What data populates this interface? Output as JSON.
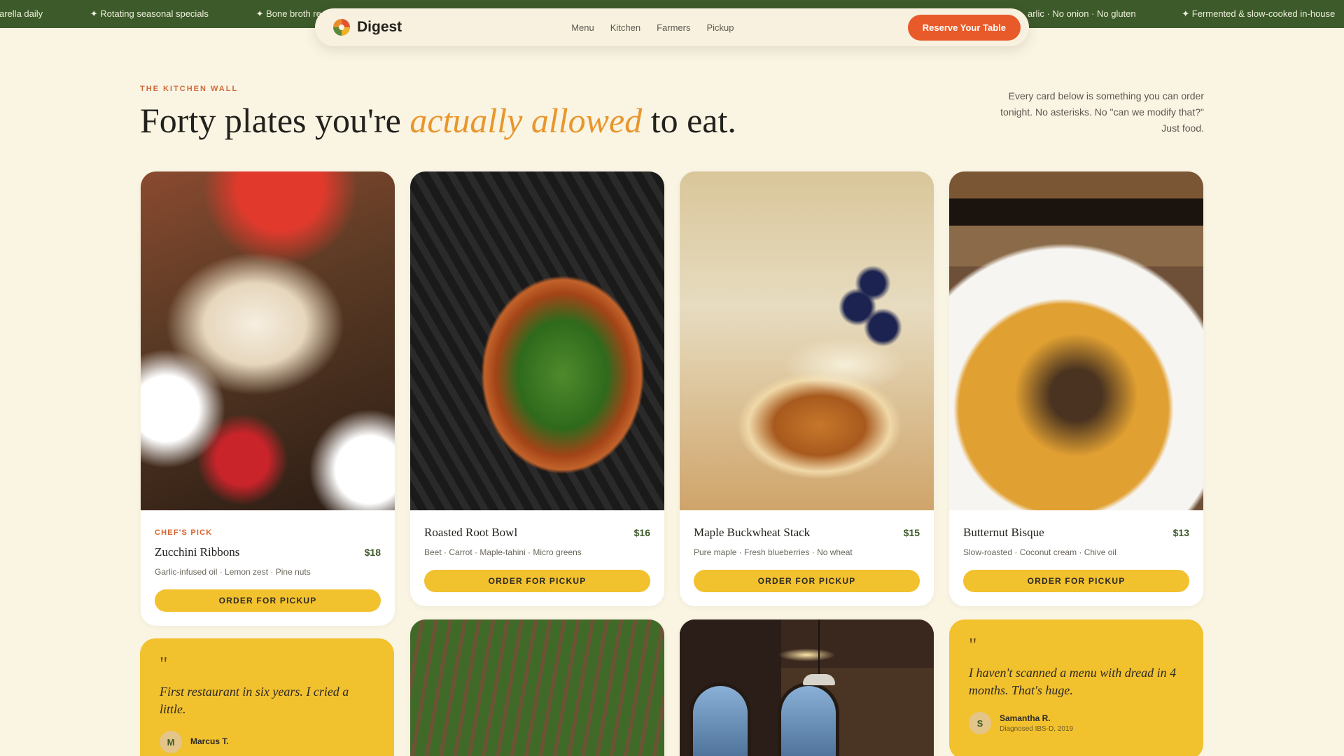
{
  "ticker": {
    "items": [
      "zzarella daily",
      "✦ Rotating seasonal specials",
      "✦ Bone broth re",
      "arlic · No onion · No gluten",
      "✦ Fermented & slow-cooked in-house"
    ]
  },
  "navbar": {
    "brand": "Digest",
    "links": [
      "Menu",
      "Kitchen",
      "Farmers",
      "Pickup"
    ],
    "cta": "Reserve Your Table"
  },
  "hero": {
    "eyebrow": "THE KITCHEN WALL",
    "headline_before": "Forty plates you're ",
    "headline_accent": "actually allowed",
    "headline_after": " to eat.",
    "intro": "Every card below is something you can order tonight. No asterisks. No \"can we modify that?\" Just food."
  },
  "menu_cards": [
    {
      "badge": "CHEF'S PICK",
      "name": "Zucchini Ribbons",
      "price": "$18",
      "ingredients": "Garlic-infused oil · Lemon zest · Pine nuts",
      "button": "ORDER FOR PICKUP"
    },
    {
      "name": "Roasted Root Bowl",
      "price": "$16",
      "ingredients": "Beet · Carrot · Maple-tahini · Micro greens",
      "button": "ORDER FOR PICKUP"
    },
    {
      "name": "Maple Buckwheat Stack",
      "price": "$15",
      "ingredients": "Pure maple · Fresh blueberries · No wheat",
      "button": "ORDER FOR PICKUP"
    },
    {
      "name": "Butternut Bisque",
      "price": "$13",
      "ingredients": "Slow-roasted · Coconut cream · Chive oil",
      "button": "ORDER FOR PICKUP"
    }
  ],
  "testimonials": [
    {
      "mark": "\"",
      "quote": "First restaurant in six years. I cried a little.",
      "initial": "M",
      "name": "Marcus T.",
      "meta": ""
    },
    {
      "mark": "\"",
      "quote": "I haven't scanned a menu with dread in 4 months. That's huge.",
      "initial": "S",
      "name": "Samantha R.",
      "meta": "Diagnosed IBS-D, 2019"
    }
  ],
  "colors": {
    "ticker_bg": "#3d5a2a",
    "accent_orange": "#e85a2a",
    "accent_yellow": "#f2c12e",
    "page_bg": "#faf4e3"
  }
}
